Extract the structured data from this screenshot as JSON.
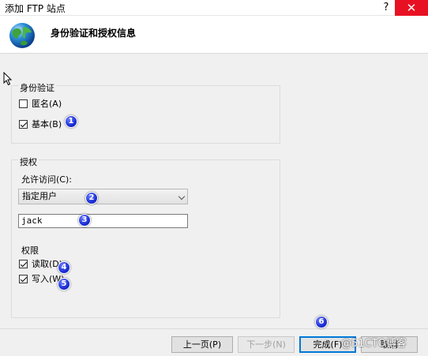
{
  "window": {
    "title": "添加 FTP 站点",
    "help_glyph": "?",
    "close_glyph": "✕"
  },
  "header": {
    "title": "身份验证和授权信息",
    "icon": "globe-icon"
  },
  "authentication": {
    "label": "身份验证",
    "anonymous": {
      "label": "匿名(A)",
      "checked": false
    },
    "basic": {
      "label": "基本(B)",
      "checked": true
    }
  },
  "authorization": {
    "label": "授权",
    "allow_access_label": "允许访问(C):",
    "allow_access_value": "指定用户",
    "user_value": "jack",
    "permissions_label": "权限",
    "read": {
      "label": "读取(D)",
      "checked": true
    },
    "write": {
      "label": "写入(W)",
      "checked": true
    }
  },
  "annotations": [
    "1",
    "2",
    "3",
    "4",
    "5",
    "6"
  ],
  "footer": {
    "prev_label": "上一页(P)",
    "next_label": "下一步(N)",
    "finish_label": "完成(F)",
    "cancel_label": "取消"
  },
  "watermark": "@51CTO博客",
  "colors": {
    "close": "#e81123",
    "badge": "#1c2fd6",
    "primary_border": "#0078d7"
  }
}
